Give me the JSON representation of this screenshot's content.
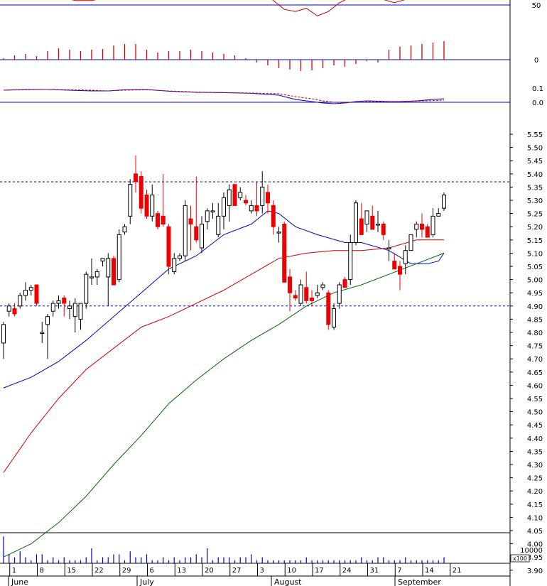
{
  "chart_data": {
    "type": "candlestick",
    "x_tick_labels": [
      "1",
      "8",
      "15",
      "22",
      "29",
      "6",
      "13",
      "20",
      "27",
      "3",
      "10",
      "17",
      "24",
      "31",
      "7",
      "14",
      "21"
    ],
    "month_labels": [
      "June",
      "July",
      "August",
      "September"
    ],
    "price_axis": {
      "ticks": [
        "5.55",
        "5.50",
        "5.45",
        "5.40",
        "5.35",
        "5.30",
        "5.25",
        "5.20",
        "5.15",
        "5.10",
        "5.05",
        "5.00",
        "4.95",
        "4.90",
        "4.85",
        "4.80",
        "4.75",
        "4.70",
        "4.65",
        "4.60",
        "4.55",
        "4.50",
        "4.45",
        "4.40",
        "4.35",
        "4.30",
        "4.25",
        "4.20",
        "4.15",
        "4.10",
        "4.05",
        "4.00",
        "3.95",
        "3.90"
      ],
      "range": [
        3.86,
        5.58
      ],
      "reference_lines": [
        5.37,
        4.9
      ]
    },
    "rsi_panel": {
      "ticks": [
        "50",
        "0"
      ],
      "range": [
        -20,
        70
      ]
    },
    "macd_panel": {
      "ticks": [
        "0.1",
        "0.0"
      ],
      "range": [
        -0.05,
        0.13
      ]
    },
    "volume_panel": {
      "ticks": [
        "10000"
      ],
      "unit_label": "x100"
    },
    "candles": [
      [
        4.76,
        4.84,
        4.7,
        4.83
      ],
      [
        4.88,
        4.91,
        4.86,
        4.9
      ],
      [
        4.89,
        4.91,
        4.86,
        4.87
      ],
      [
        4.9,
        4.95,
        4.89,
        4.94
      ],
      [
        4.94,
        4.99,
        4.92,
        4.96
      ],
      [
        4.96,
        4.98,
        4.94,
        4.97
      ],
      [
        4.98,
        4.98,
        4.9,
        4.91
      ],
      [
        4.8,
        4.84,
        4.76,
        4.8
      ],
      [
        4.83,
        4.87,
        4.7,
        4.86
      ],
      [
        4.88,
        4.92,
        4.86,
        4.91
      ],
      [
        4.91,
        4.94,
        4.89,
        4.92
      ],
      [
        4.93,
        4.94,
        4.86,
        4.91
      ],
      [
        4.89,
        4.92,
        4.85,
        4.9
      ],
      [
        4.86,
        4.93,
        4.8,
        4.91
      ],
      [
        4.85,
        4.91,
        4.81,
        4.91
      ],
      [
        4.91,
        5.03,
        4.89,
        5.02
      ],
      [
        5.01,
        5.08,
        4.98,
        5.01
      ],
      [
        5.01,
        5.04,
        4.98,
        5.03
      ],
      [
        5.07,
        5.08,
        5.05,
        5.08
      ],
      [
        5.01,
        5.1,
        4.9,
        5.08
      ],
      [
        5.08,
        5.09,
        5.0,
        4.98
      ],
      [
        5.0,
        5.19,
        4.99,
        5.17
      ],
      [
        5.18,
        5.21,
        5.17,
        5.2
      ],
      [
        5.24,
        5.38,
        5.21,
        5.36
      ],
      [
        5.4,
        5.47,
        5.33,
        5.37
      ],
      [
        5.39,
        5.41,
        5.25,
        5.27
      ],
      [
        5.32,
        5.34,
        5.23,
        5.24
      ],
      [
        5.24,
        5.36,
        5.22,
        5.32
      ],
      [
        5.25,
        5.26,
        5.19,
        5.2
      ],
      [
        5.24,
        5.4,
        5.2,
        5.21
      ],
      [
        5.2,
        5.21,
        5.02,
        5.05
      ],
      [
        5.03,
        5.1,
        5.02,
        5.08
      ],
      [
        5.08,
        5.1,
        5.07,
        5.09
      ],
      [
        5.09,
        5.3,
        5.07,
        5.28
      ],
      [
        5.23,
        5.28,
        5.11,
        5.21
      ],
      [
        5.2,
        5.39,
        5.14,
        5.15
      ],
      [
        5.12,
        5.24,
        5.1,
        5.21
      ],
      [
        5.22,
        5.27,
        5.19,
        5.26
      ],
      [
        5.26,
        5.29,
        5.23,
        5.26
      ],
      [
        5.17,
        5.29,
        5.16,
        5.24
      ],
      [
        5.24,
        5.33,
        5.19,
        5.31
      ],
      [
        5.28,
        5.36,
        5.22,
        5.34
      ],
      [
        5.36,
        5.36,
        5.29,
        5.28
      ],
      [
        5.31,
        5.35,
        5.3,
        5.33
      ],
      [
        5.3,
        5.32,
        5.28,
        5.29
      ],
      [
        5.26,
        5.3,
        5.25,
        5.28
      ],
      [
        5.28,
        5.37,
        5.24,
        5.26
      ],
      [
        5.28,
        5.41,
        5.25,
        5.35
      ],
      [
        5.33,
        5.36,
        5.25,
        5.29
      ],
      [
        5.28,
        5.3,
        5.17,
        5.2
      ],
      [
        5.18,
        5.2,
        5.14,
        5.18
      ],
      [
        5.21,
        5.22,
        4.99,
        4.99
      ],
      [
        5.01,
        5.04,
        4.88,
        4.95
      ],
      [
        4.94,
        4.96,
        4.92,
        4.93
      ],
      [
        4.91,
        5.0,
        4.9,
        4.98
      ],
      [
        4.97,
        5.03,
        4.91,
        4.92
      ],
      [
        4.93,
        4.96,
        4.9,
        4.92
      ],
      [
        4.94,
        4.98,
        4.93,
        4.95
      ],
      [
        4.97,
        4.99,
        4.96,
        4.98
      ],
      [
        4.95,
        4.96,
        4.81,
        4.83
      ],
      [
        4.82,
        4.91,
        4.81,
        4.89
      ],
      [
        4.91,
        4.99,
        4.89,
        4.98
      ],
      [
        5.0,
        5.01,
        4.97,
        4.97
      ],
      [
        5.0,
        5.17,
        4.98,
        5.14
      ],
      [
        5.14,
        5.3,
        5.13,
        5.29
      ],
      [
        5.23,
        5.29,
        5.17,
        5.17
      ],
      [
        5.21,
        5.26,
        5.18,
        5.26
      ],
      [
        5.24,
        5.28,
        5.19,
        5.19
      ],
      [
        5.21,
        5.26,
        5.18,
        5.21
      ],
      [
        5.21,
        5.22,
        5.15,
        5.17
      ],
      [
        5.12,
        5.15,
        5.07,
        5.12
      ],
      [
        5.07,
        5.1,
        5.04,
        5.04
      ],
      [
        5.05,
        5.07,
        4.96,
        5.02
      ],
      [
        5.06,
        5.13,
        5.02,
        5.11
      ],
      [
        5.11,
        5.17,
        5.11,
        5.17
      ],
      [
        5.19,
        5.22,
        5.16,
        5.21
      ],
      [
        5.21,
        5.25,
        5.16,
        5.19
      ],
      [
        5.2,
        5.21,
        5.16,
        5.16
      ],
      [
        5.17,
        5.27,
        5.16,
        5.24
      ],
      [
        5.24,
        5.27,
        5.24,
        5.25
      ],
      [
        5.27,
        5.33,
        5.26,
        5.32
      ]
    ],
    "volume": [
      9,
      3,
      2,
      4,
      2,
      1,
      3,
      3,
      1,
      2,
      1,
      2,
      1,
      1,
      1,
      2,
      5,
      1,
      2,
      2,
      3,
      3,
      1,
      4,
      2,
      2,
      3,
      1,
      1,
      2,
      1,
      2,
      1,
      2,
      2,
      3,
      2,
      5,
      1,
      2,
      2,
      2,
      1,
      2,
      2,
      3,
      1,
      2,
      1,
      1,
      1,
      1,
      1,
      1,
      1,
      2,
      1,
      1,
      1,
      1,
      1,
      1,
      1,
      1,
      1,
      2,
      1,
      1,
      2,
      2,
      1,
      1,
      1,
      2,
      1,
      1,
      1,
      1,
      1,
      1,
      2
    ],
    "series": [
      {
        "name": "",
        "kind": "ma_short",
        "color": "#0000cc",
        "points": [
          [
            0,
            4.59
          ],
          [
            5,
            4.63
          ],
          [
            10,
            4.69
          ],
          [
            15,
            4.77
          ],
          [
            20,
            4.86
          ],
          [
            25,
            4.95
          ],
          [
            30,
            5.04
          ],
          [
            35,
            5.09
          ],
          [
            40,
            5.17
          ],
          [
            45,
            5.21
          ],
          [
            48,
            5.26
          ],
          [
            50,
            5.25
          ],
          [
            53,
            5.2
          ],
          [
            57,
            5.17
          ],
          [
            62,
            5.14
          ],
          [
            65,
            5.14
          ],
          [
            70,
            5.11
          ],
          [
            74,
            5.06
          ],
          [
            77,
            5.06
          ],
          [
            79,
            5.07
          ],
          [
            80,
            5.1
          ]
        ]
      },
      {
        "name": "",
        "kind": "ma_mid",
        "color": "#cc0000",
        "points": [
          [
            0,
            4.27
          ],
          [
            5,
            4.42
          ],
          [
            10,
            4.55
          ],
          [
            15,
            4.66
          ],
          [
            20,
            4.74
          ],
          [
            25,
            4.82
          ],
          [
            30,
            4.86
          ],
          [
            35,
            4.91
          ],
          [
            40,
            4.96
          ],
          [
            45,
            5.02
          ],
          [
            50,
            5.08
          ],
          [
            55,
            5.1
          ],
          [
            60,
            5.11
          ],
          [
            65,
            5.11
          ],
          [
            70,
            5.12
          ],
          [
            75,
            5.15
          ],
          [
            80,
            5.15
          ]
        ]
      },
      {
        "name": "",
        "kind": "ma_long",
        "color": "#006600",
        "points": [
          [
            0,
            3.95
          ],
          [
            5,
            4.0
          ],
          [
            10,
            4.08
          ],
          [
            15,
            4.18
          ],
          [
            20,
            4.3
          ],
          [
            25,
            4.41
          ],
          [
            30,
            4.53
          ],
          [
            35,
            4.62
          ],
          [
            40,
            4.7
          ],
          [
            45,
            4.77
          ],
          [
            50,
            4.83
          ],
          [
            55,
            4.9
          ],
          [
            60,
            4.95
          ],
          [
            65,
            4.98
          ],
          [
            70,
            5.02
          ],
          [
            75,
            5.06
          ],
          [
            80,
            5.1
          ]
        ]
      },
      {
        "name": "",
        "kind": "rsi",
        "color": "#cc0000",
        "points": [
          [
            0,
            65
          ],
          [
            3,
            62
          ],
          [
            5,
            60
          ],
          [
            8,
            56
          ],
          [
            10,
            58
          ],
          [
            13,
            54
          ],
          [
            16,
            54
          ],
          [
            19,
            57
          ],
          [
            22,
            61
          ],
          [
            25,
            64
          ],
          [
            27,
            60
          ],
          [
            29,
            55
          ],
          [
            31,
            58
          ],
          [
            34,
            58
          ],
          [
            37,
            63
          ],
          [
            40,
            61
          ],
          [
            43,
            56
          ],
          [
            45,
            58
          ],
          [
            47,
            63
          ],
          [
            49,
            54
          ],
          [
            51,
            46
          ],
          [
            53,
            44
          ],
          [
            55,
            47
          ],
          [
            57,
            40
          ],
          [
            59,
            44
          ],
          [
            61,
            52
          ],
          [
            63,
            57
          ],
          [
            65,
            60
          ],
          [
            67,
            57
          ],
          [
            69,
            55
          ],
          [
            71,
            52
          ],
          [
            73,
            55
          ],
          [
            75,
            58
          ],
          [
            77,
            57
          ],
          [
            79,
            60
          ],
          [
            80,
            60
          ]
        ]
      },
      {
        "name": "",
        "kind": "rsi_bars",
        "color": "#cc0000",
        "points": [
          [
            0,
            2
          ],
          [
            2,
            6
          ],
          [
            4,
            8
          ],
          [
            6,
            5
          ],
          [
            8,
            12
          ],
          [
            10,
            16
          ],
          [
            12,
            14
          ],
          [
            14,
            12
          ],
          [
            16,
            14
          ],
          [
            18,
            15
          ],
          [
            20,
            20
          ],
          [
            22,
            22
          ],
          [
            24,
            22
          ],
          [
            26,
            14
          ],
          [
            28,
            10
          ],
          [
            30,
            12
          ],
          [
            32,
            12
          ],
          [
            34,
            14
          ],
          [
            36,
            12
          ],
          [
            38,
            10
          ],
          [
            40,
            8
          ],
          [
            42,
            6
          ],
          [
            44,
            2
          ],
          [
            46,
            -4
          ],
          [
            48,
            -8
          ],
          [
            50,
            -12
          ],
          [
            52,
            -14
          ],
          [
            54,
            -16
          ],
          [
            56,
            -15
          ],
          [
            58,
            -12
          ],
          [
            60,
            -8
          ],
          [
            62,
            -10
          ],
          [
            64,
            -6
          ],
          [
            66,
            -2
          ],
          [
            68,
            -4
          ],
          [
            70,
            14
          ],
          [
            72,
            18
          ],
          [
            74,
            20
          ],
          [
            76,
            22
          ],
          [
            78,
            24
          ],
          [
            80,
            26
          ]
        ]
      },
      {
        "name": "",
        "kind": "macd",
        "color": "#0000cc",
        "points": [
          [
            0,
            0.085
          ],
          [
            4,
            0.09
          ],
          [
            8,
            0.09
          ],
          [
            12,
            0.085
          ],
          [
            16,
            0.08
          ],
          [
            19,
            0.08
          ],
          [
            22,
            0.088
          ],
          [
            26,
            0.09
          ],
          [
            30,
            0.078
          ],
          [
            35,
            0.07
          ],
          [
            40,
            0.068
          ],
          [
            45,
            0.063
          ],
          [
            50,
            0.05
          ],
          [
            53,
            0.02
          ],
          [
            56,
            0.005
          ],
          [
            58,
            -0.005
          ],
          [
            60,
            -0.01
          ],
          [
            62,
            -0.005
          ],
          [
            64,
            0.005
          ],
          [
            66,
            0.01
          ],
          [
            68,
            0.008
          ],
          [
            70,
            0.005
          ],
          [
            72,
            0.005
          ],
          [
            75,
            0.01
          ],
          [
            78,
            0.02
          ],
          [
            80,
            0.025
          ]
        ]
      },
      {
        "name": "",
        "kind": "macd_signal",
        "color": "#cc0000",
        "points": [
          [
            0,
            0.085
          ],
          [
            4,
            0.088
          ],
          [
            8,
            0.09
          ],
          [
            12,
            0.088
          ],
          [
            16,
            0.085
          ],
          [
            19,
            0.08
          ],
          [
            22,
            0.085
          ],
          [
            26,
            0.088
          ],
          [
            30,
            0.08
          ],
          [
            35,
            0.072
          ],
          [
            40,
            0.068
          ],
          [
            45,
            0.065
          ],
          [
            50,
            0.06
          ],
          [
            53,
            0.04
          ],
          [
            56,
            0.025
          ],
          [
            58,
            0.01
          ],
          [
            60,
            0.0
          ],
          [
            62,
            -0.003
          ],
          [
            64,
            0.0
          ],
          [
            66,
            0.003
          ],
          [
            68,
            0.005
          ],
          [
            70,
            0.005
          ],
          [
            72,
            0.005
          ],
          [
            75,
            0.008
          ],
          [
            78,
            0.012
          ],
          [
            80,
            0.015
          ]
        ]
      }
    ]
  }
}
